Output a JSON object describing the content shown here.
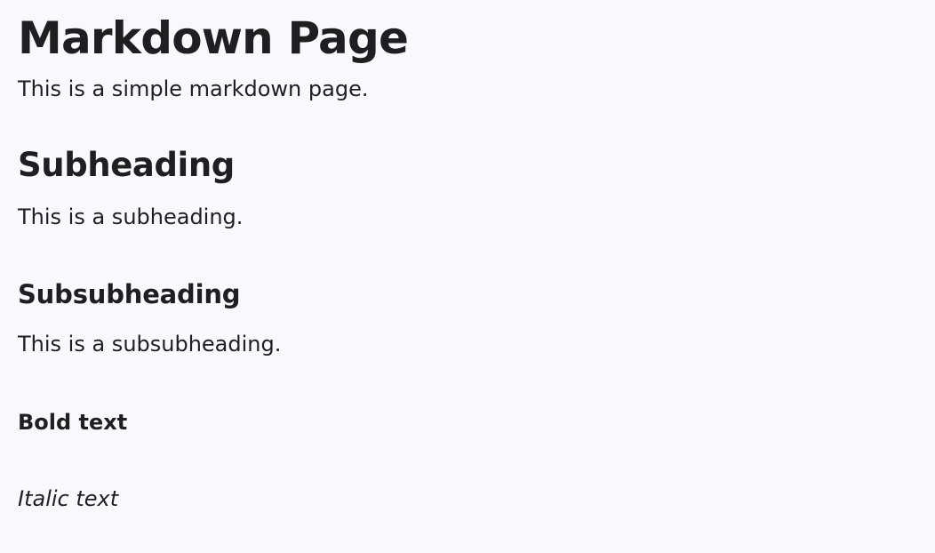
{
  "content": {
    "title": "Markdown Page",
    "intro": "This is a simple markdown page.",
    "subheading": "Subheading",
    "subheading_text": "This is a subheading.",
    "subsubheading": "Subsubheading",
    "subsubheading_text": "This is a subsubheading.",
    "bold_text": "Bold text",
    "italic_text": "Italic text"
  }
}
